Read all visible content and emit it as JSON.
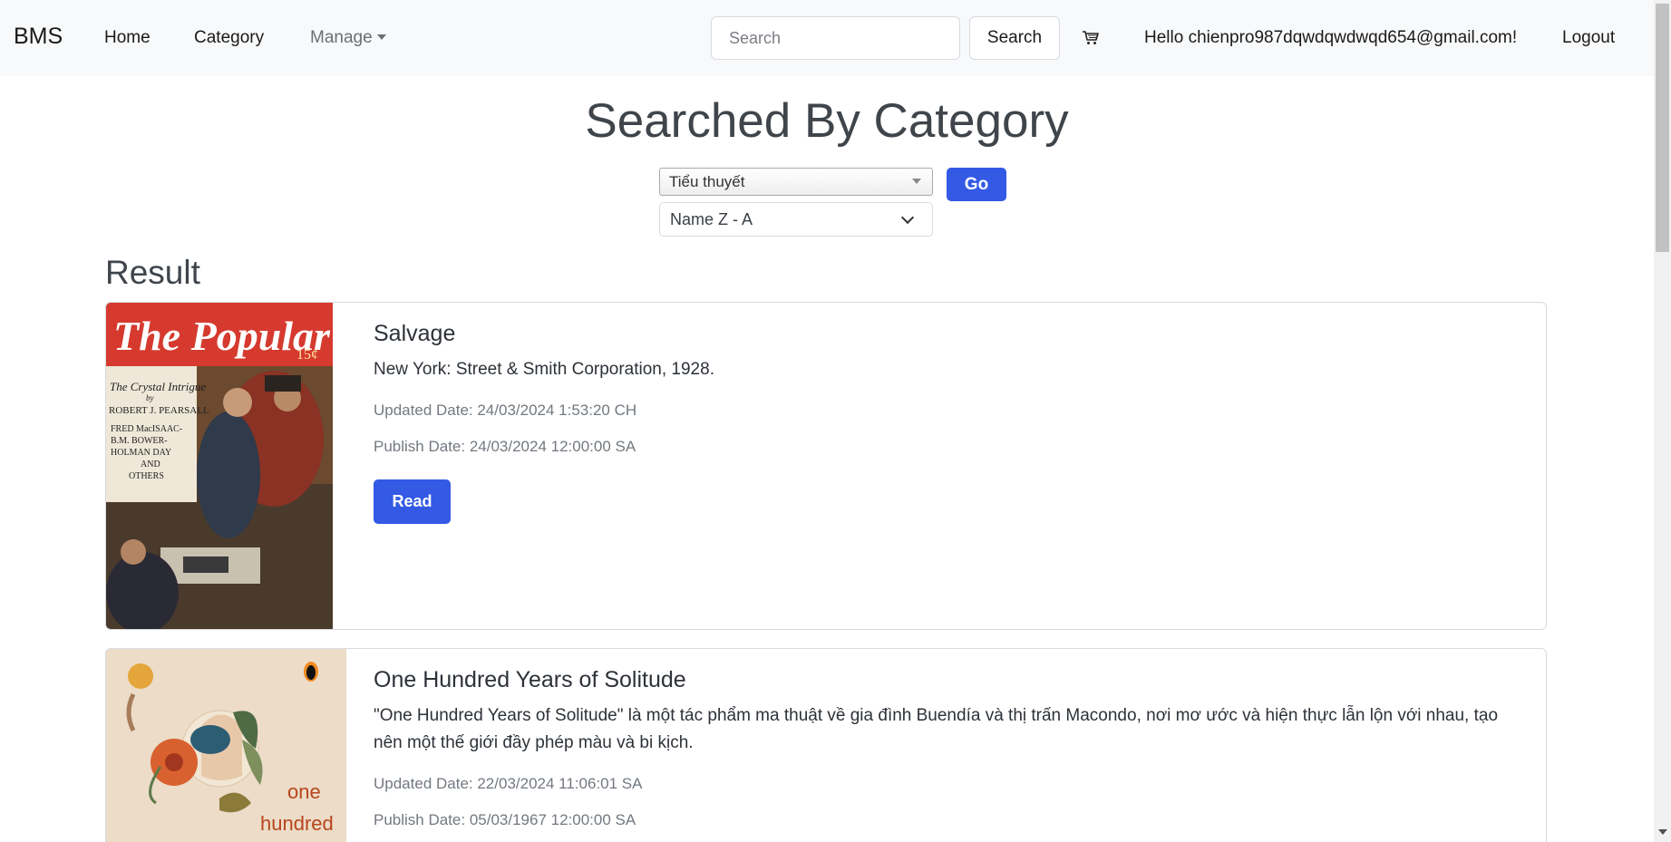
{
  "navbar": {
    "brand": "BMS",
    "home_label": "Home",
    "category_label": "Category",
    "manage_label": "Manage",
    "search_placeholder": "Search",
    "search_button_label": "Search",
    "cart_icon": "cart-icon",
    "greeting": "Hello chienpro987dqwdqwdwqd654@gmail.com!",
    "logout_label": "Logout"
  },
  "page": {
    "title": "Searched By Category",
    "category_selected": "Tiểu thuyết",
    "go_label": "Go",
    "sort_selected": "Name Z - A",
    "result_heading": "Result"
  },
  "books": [
    {
      "title": "Salvage",
      "description": "New York: Street & Smith Corporation, 1928.",
      "updated": "Updated Date: 24/03/2024 1:53:20 CH",
      "published": "Publish Date: 24/03/2024 12:00:00 SA",
      "read_label": "Read",
      "cover": {
        "masthead": "The Popular",
        "price": "15¢",
        "story": "The Crystal Intrigue",
        "by": "by",
        "author": "ROBERT J. PEARSALL",
        "others_1": "FRED MacISAAC-",
        "others_2": "B.M. BOWER-",
        "others_3": "HOLMAN DAY",
        "others_4": "AND",
        "others_5": "OTHERS"
      }
    },
    {
      "title": "One Hundred Years of Solitude",
      "description": "\"One Hundred Years of Solitude\" là một tác phẩm ma thuật về gia đình Buendía và thị trấn Macondo, nơi mơ ước và hiện thực lẫn lộn với nhau, tạo nên một thế giới đầy phép màu và bi kịch.",
      "updated": "Updated Date: 22/03/2024 11:06:01 SA",
      "published": "Publish Date: 05/03/1967 12:00:00 SA",
      "cover": {
        "word_1": "one",
        "word_2": "hundred"
      }
    }
  ],
  "colors": {
    "primary": "#3359e5",
    "navbar_bg": "#f8f9fa",
    "heading": "#3f454b",
    "muted": "#737980"
  }
}
